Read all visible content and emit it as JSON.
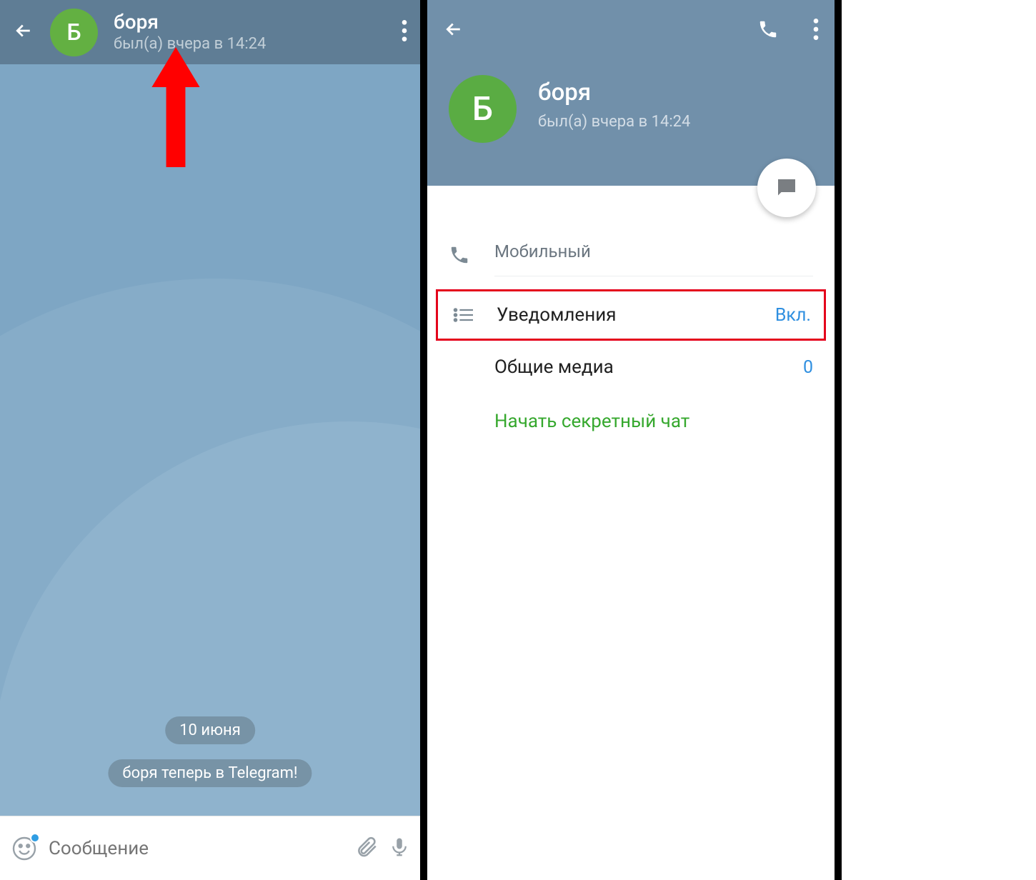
{
  "left": {
    "avatar_letter": "Б",
    "title": "боря",
    "subtitle": "был(а) вчера в 14:24",
    "date_pill": "10 июня",
    "system_msg": "боря теперь в Telegram!",
    "input_placeholder": "Сообщение"
  },
  "right": {
    "avatar_letter": "Б",
    "name": "боря",
    "status": "был(а) вчера в 14:24",
    "phone_label": "Мобильный",
    "notifications_label": "Уведомления",
    "notifications_value": "Вкл.",
    "shared_media_label": "Общие медиа",
    "shared_media_value": "0",
    "secret_chat": "Начать секретный чат"
  }
}
